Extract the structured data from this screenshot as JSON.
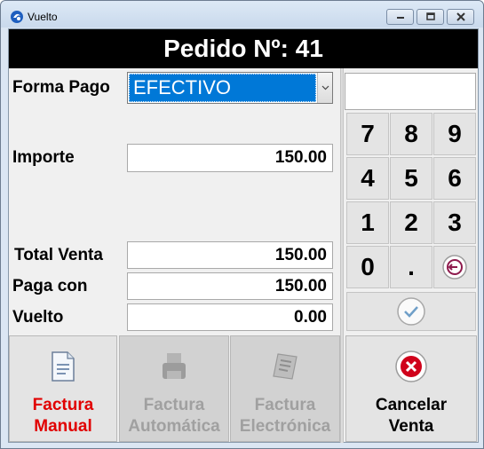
{
  "window": {
    "title": "Vuelto"
  },
  "header": {
    "title": "Pedido Nº: 41"
  },
  "form": {
    "forma_pago_label": "Forma Pago",
    "forma_pago_value": "EFECTIVO",
    "importe_label": "Importe",
    "importe_value": "150.00",
    "total_venta_label": "Total Venta",
    "total_venta_value": "150.00",
    "paga_con_label": "Paga con",
    "paga_con_value": "150.00",
    "vuelto_label": "Vuelto",
    "vuelto_value": "0.00"
  },
  "keypad": {
    "keys": [
      "7",
      "8",
      "9",
      "4",
      "5",
      "6",
      "1",
      "2",
      "3",
      "0",
      "."
    ],
    "display_value": ""
  },
  "actions": {
    "factura_manual_line1": "Factura",
    "factura_manual_line2": "Manual",
    "factura_automatica_line1": "Factura",
    "factura_automatica_line2": "Automática",
    "factura_electronica_line1": "Factura",
    "factura_electronica_line2": "Electrónica",
    "cancelar_line1": "Cancelar",
    "cancelar_line2": "Venta"
  },
  "colors": {
    "accent": "#0078d7",
    "manual_text": "#e10000",
    "cancel_icon": "#d0021b",
    "backspace_icon": "#8e1a4d"
  },
  "icons": {
    "app": "app-logo-icon",
    "backspace": "backspace-icon",
    "confirm": "checkmark-icon",
    "manual": "document-icon",
    "automatica": "printer-icon",
    "electronica": "electronic-invoice-icon",
    "cancel": "close-icon"
  }
}
